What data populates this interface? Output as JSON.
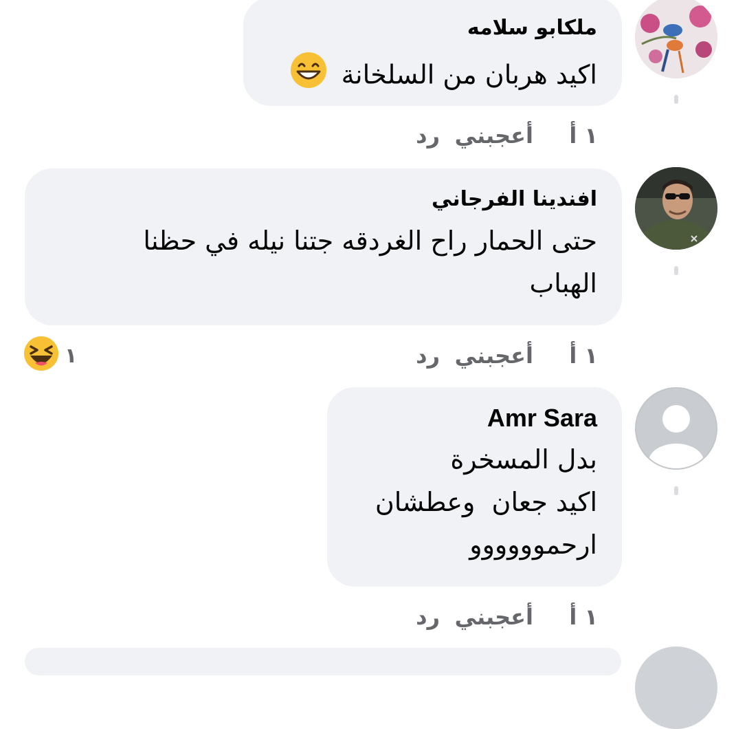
{
  "comments": [
    {
      "author": "ملكابو سلامه",
      "lines": [
        "اكيد هربان من السلخانة"
      ],
      "time": "١ أ",
      "like_label": "أعجبني",
      "reply_label": "رد"
    },
    {
      "author": "افندينا الفرجاني",
      "lines": [
        "حتى الحمار راح الغردقه جتنا نيله في حظنا",
        "الهباب"
      ],
      "time": "١ أ",
      "like_label": "أعجبني",
      "reply_label": "رد",
      "reaction_count": "١"
    },
    {
      "author": "Amr Sara",
      "lines": [
        "بدل المسخرة",
        "اكيد جعان  وعطشان",
        "ارحموووووو"
      ],
      "time": "١ أ",
      "like_label": "أعجبني",
      "reply_label": "رد"
    }
  ],
  "colors": {
    "bubble": "#f0f2f5",
    "meta_text": "#65676b",
    "emoji_yellow": "#f7c035"
  },
  "icons": [
    "smiling-emoji-icon",
    "laughing-emoji-icon",
    "default-profile-icon"
  ]
}
